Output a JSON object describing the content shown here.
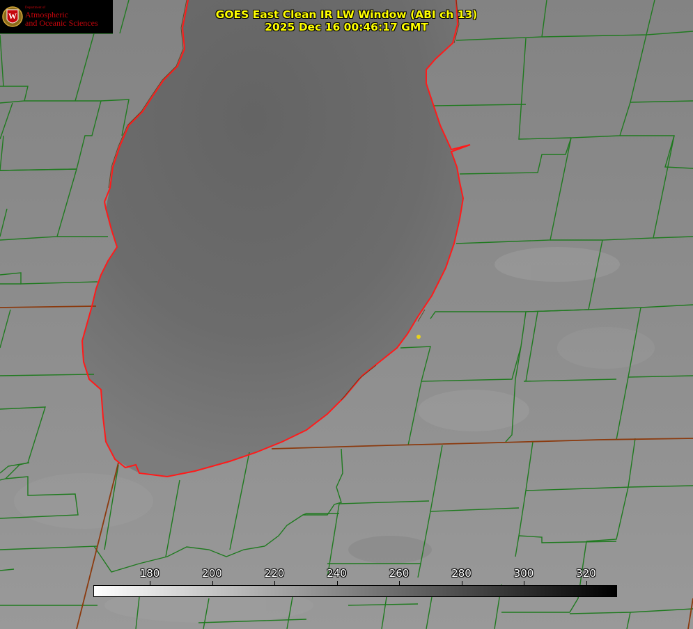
{
  "header": {
    "title_line1": "GOES East Clean IR LW Window (ABI ch 13)",
    "title_line2": "2025 Dec 16 00:46:17 GMT"
  },
  "logo": {
    "dept": "Department of",
    "name_line1": "Atmospheric",
    "name_line2": "and Oceanic Sciences",
    "shield_letter": "W"
  },
  "colorbar": {
    "ticks": [
      "180",
      "200",
      "220",
      "240",
      "260",
      "280",
      "300",
      "320"
    ],
    "gradient_from": "#ffffff",
    "gradient_to": "#000000"
  },
  "colors": {
    "county_lines": "#1f7a1f",
    "state_lines": "#8b3a0e",
    "coastline": "#ff1a1a",
    "marker": "#e8d21a",
    "lake": "#6e6e6e",
    "land": "#8f8f8f"
  }
}
